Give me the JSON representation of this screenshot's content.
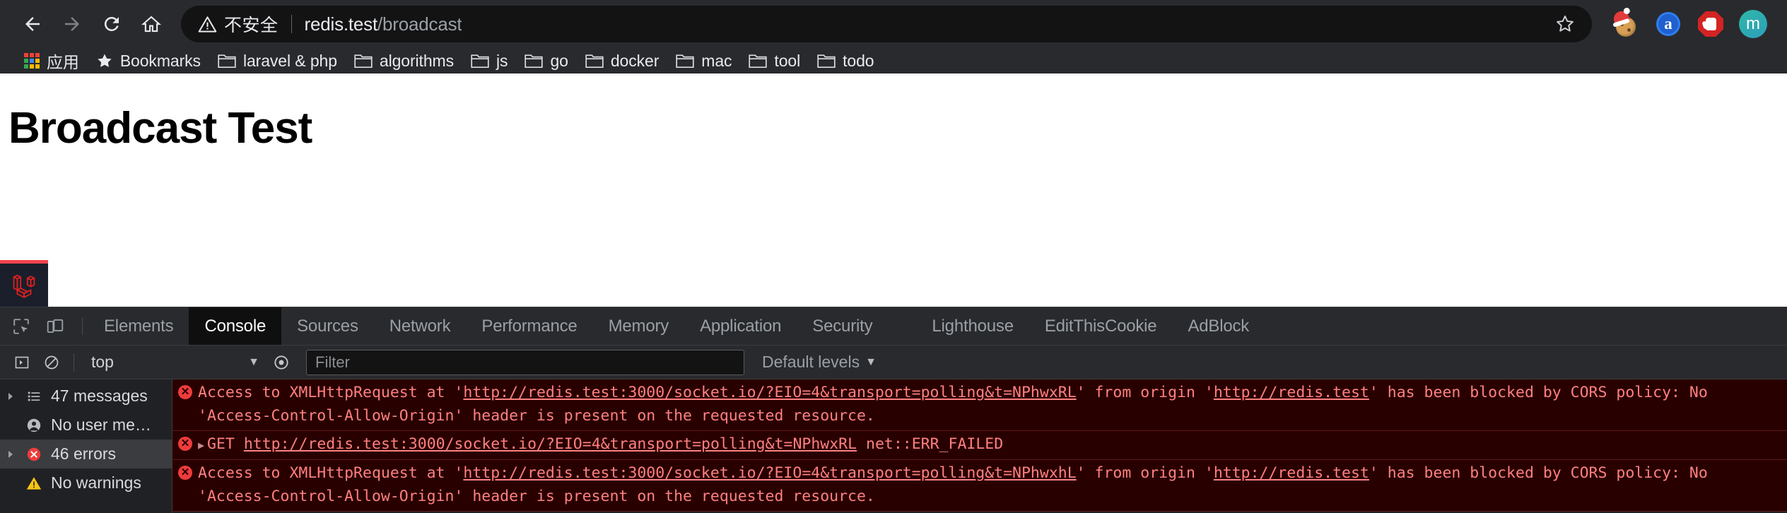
{
  "browser": {
    "nav": {
      "back_label": "Back",
      "forward_label": "Forward",
      "reload_label": "Reload",
      "home_label": "Home"
    },
    "omnibox": {
      "security_text": "不安全",
      "url_host": "redis.test",
      "url_path": "/broadcast",
      "bookmark_star_label": "Bookmark this tab"
    },
    "extensions": [
      {
        "name": "editthiscookie-icon",
        "label": "EditThisCookie"
      },
      {
        "name": "a-extension-icon",
        "label": "a"
      },
      {
        "name": "adblock-icon",
        "label": "AdBlock"
      },
      {
        "name": "profile-avatar",
        "label": "m"
      }
    ],
    "bookmarks": [
      {
        "label": "应用",
        "icon": "apps-grid-icon"
      },
      {
        "label": "Bookmarks",
        "icon": "star-icon"
      },
      {
        "label": "laravel & php",
        "icon": "folder-icon"
      },
      {
        "label": "algorithms",
        "icon": "folder-icon"
      },
      {
        "label": "js",
        "icon": "folder-icon"
      },
      {
        "label": "go",
        "icon": "folder-icon"
      },
      {
        "label": "docker",
        "icon": "folder-icon"
      },
      {
        "label": "mac",
        "icon": "folder-icon"
      },
      {
        "label": "tool",
        "icon": "folder-icon"
      },
      {
        "label": "todo",
        "icon": "folder-icon"
      }
    ]
  },
  "page": {
    "heading": "Broadcast Test",
    "debugbar_label": "Laravel Debugbar"
  },
  "devtools": {
    "tabs": [
      {
        "label": "Elements",
        "active": false
      },
      {
        "label": "Console",
        "active": true
      },
      {
        "label": "Sources",
        "active": false
      },
      {
        "label": "Network",
        "active": false
      },
      {
        "label": "Performance",
        "active": false
      },
      {
        "label": "Memory",
        "active": false
      },
      {
        "label": "Application",
        "active": false
      },
      {
        "label": "Security",
        "active": false
      },
      {
        "label": "Lighthouse",
        "active": false
      },
      {
        "label": "EditThisCookie",
        "active": false
      },
      {
        "label": "AdBlock",
        "active": false
      }
    ],
    "console_toolbar": {
      "sidebar_toggle_label": "Show console sidebar",
      "clear_label": "Clear console",
      "context": "top",
      "live_expression_label": "Create live expression",
      "filter_placeholder": "Filter",
      "filter_value": "",
      "levels_label": "Default levels"
    },
    "console_sidebar": [
      {
        "label": "47 messages",
        "icon": "list-icon",
        "expandable": true,
        "selected": false
      },
      {
        "label": "No user me…",
        "icon": "user-icon",
        "expandable": false,
        "selected": false
      },
      {
        "label": "46 errors",
        "icon": "error-icon",
        "expandable": true,
        "selected": true
      },
      {
        "label": "No warnings",
        "icon": "warning-icon",
        "expandable": false,
        "selected": false
      }
    ],
    "console_messages": [
      {
        "type": "error",
        "expandable": false,
        "parts": [
          {
            "t": "Access to XMLHttpRequest at '",
            "link": false
          },
          {
            "t": "http://redis.test:3000/socket.io/?EIO=4&transport=polling&t=NPhwxRL",
            "link": true
          },
          {
            "t": "' from origin '",
            "link": false
          },
          {
            "t": "http://redis.test",
            "link": true
          },
          {
            "t": "' has been blocked by CORS policy: No 'Access-Control-Allow-Origin' header is present on the requested resource.",
            "link": false
          }
        ]
      },
      {
        "type": "error",
        "expandable": true,
        "parts": [
          {
            "t": "GET ",
            "link": false
          },
          {
            "t": "http://redis.test:3000/socket.io/?EIO=4&transport=polling&t=NPhwxRL",
            "link": true
          },
          {
            "t": " net::ERR_FAILED",
            "link": false
          }
        ]
      },
      {
        "type": "error",
        "expandable": false,
        "parts": [
          {
            "t": "Access to XMLHttpRequest at '",
            "link": false
          },
          {
            "t": "http://redis.test:3000/socket.io/?EIO=4&transport=polling&t=NPhwxhL",
            "link": true
          },
          {
            "t": "' from origin '",
            "link": false
          },
          {
            "t": "http://redis.test",
            "link": true
          },
          {
            "t": "' has been blocked by CORS policy: No 'Access-Control-Allow-Origin' header is present on the requested resource.",
            "link": false
          }
        ]
      }
    ]
  },
  "colors": {
    "chrome_bg": "#292a2d",
    "omnibox_bg": "#131314",
    "devtools_bg": "#202124",
    "error_bg": "#290000",
    "error_text": "#ff8080",
    "accent_red": "#f4444e"
  }
}
